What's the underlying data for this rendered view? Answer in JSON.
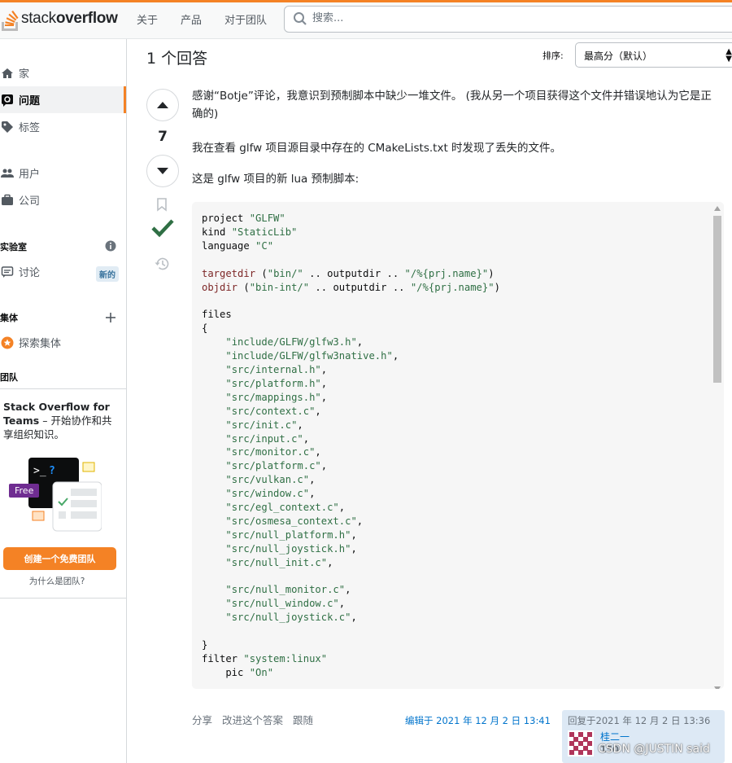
{
  "header": {
    "logo_plain": "stack",
    "logo_bold": "overflow",
    "nav": [
      "关于",
      "产品",
      "对于团队"
    ],
    "search_placeholder": "搜索..."
  },
  "sidebar": {
    "items": [
      {
        "label": "家",
        "icon": "home-icon"
      },
      {
        "label": "问题",
        "icon": "questions-icon",
        "active": true
      },
      {
        "label": "标签",
        "icon": "tag-icon"
      },
      {
        "label": "用户",
        "icon": "users-icon"
      },
      {
        "label": "公司",
        "icon": "briefcase-icon"
      }
    ],
    "labs_label": "实验室",
    "discussions_label": "讨论",
    "new_badge": "新的",
    "collectives_label": "集体",
    "explore_label": "探索集体",
    "teams_label": "团队",
    "teams_title": "Stack Overflow for Teams",
    "teams_desc": " – 开始协作和共享组织知识。",
    "free_badge": "Free",
    "cta_label": "创建一个免费团队",
    "why_link": "为什么是团队?"
  },
  "answers": {
    "count_label": "1 个回答",
    "sort_label": "排序:",
    "sort_value": "最高分（默认）"
  },
  "answer": {
    "votes": "7",
    "paragraphs": [
      "感谢“Botje”评论，我意识到预制脚本中缺少一堆文件。 (我从另一个项目获得这个文件并错误地认为它是正确的)",
      "我在查看 glfw 项目源目录中存在的 CMakeLists.txt 时发现了丢失的文件。",
      "这是 glfw 项目的新 lua 预制脚本:"
    ],
    "code_lines": [
      [
        [
          "",
          "project "
        ],
        [
          "str",
          "\"GLFW\""
        ]
      ],
      [
        [
          "",
          "kind "
        ],
        [
          "str",
          "\"StaticLib\""
        ]
      ],
      [
        [
          "",
          "language "
        ],
        [
          "str",
          "\"C\""
        ]
      ],
      [
        [
          "",
          ""
        ]
      ],
      [
        [
          "kw",
          "targetdir"
        ],
        [
          "",
          " ("
        ],
        [
          "str",
          "\"bin/\""
        ],
        [
          "",
          " .. outputdir .. "
        ],
        [
          "str",
          "\"/%{prj.name}\""
        ],
        [
          "",
          ")"
        ]
      ],
      [
        [
          "kw",
          "objdir"
        ],
        [
          "",
          " ("
        ],
        [
          "str",
          "\"bin-int/\""
        ],
        [
          "",
          " .. outputdir .. "
        ],
        [
          "str",
          "\"/%{prj.name}\""
        ],
        [
          "",
          ")"
        ]
      ],
      [
        [
          "",
          ""
        ]
      ],
      [
        [
          "",
          "files"
        ]
      ],
      [
        [
          "",
          "{"
        ]
      ],
      [
        [
          "",
          "    "
        ],
        [
          "str",
          "\"include/GLFW/glfw3.h\""
        ],
        [
          "",
          ","
        ]
      ],
      [
        [
          "",
          "    "
        ],
        [
          "str",
          "\"include/GLFW/glfw3native.h\""
        ],
        [
          "",
          ","
        ]
      ],
      [
        [
          "",
          "    "
        ],
        [
          "str",
          "\"src/internal.h\""
        ],
        [
          "",
          ","
        ]
      ],
      [
        [
          "",
          "    "
        ],
        [
          "str",
          "\"src/platform.h\""
        ],
        [
          "",
          ","
        ]
      ],
      [
        [
          "",
          "    "
        ],
        [
          "str",
          "\"src/mappings.h\""
        ],
        [
          "",
          ","
        ]
      ],
      [
        [
          "",
          "    "
        ],
        [
          "str",
          "\"src/context.c\""
        ],
        [
          "",
          ","
        ]
      ],
      [
        [
          "",
          "    "
        ],
        [
          "str",
          "\"src/init.c\""
        ],
        [
          "",
          ","
        ]
      ],
      [
        [
          "",
          "    "
        ],
        [
          "str",
          "\"src/input.c\""
        ],
        [
          "",
          ","
        ]
      ],
      [
        [
          "",
          "    "
        ],
        [
          "str",
          "\"src/monitor.c\""
        ],
        [
          "",
          ","
        ]
      ],
      [
        [
          "",
          "    "
        ],
        [
          "str",
          "\"src/platform.c\""
        ],
        [
          "",
          ","
        ]
      ],
      [
        [
          "",
          "    "
        ],
        [
          "str",
          "\"src/vulkan.c\""
        ],
        [
          "",
          ","
        ]
      ],
      [
        [
          "",
          "    "
        ],
        [
          "str",
          "\"src/window.c\""
        ],
        [
          "",
          ","
        ]
      ],
      [
        [
          "",
          "    "
        ],
        [
          "str",
          "\"src/egl_context.c\""
        ],
        [
          "",
          ","
        ]
      ],
      [
        [
          "",
          "    "
        ],
        [
          "str",
          "\"src/osmesa_context.c\""
        ],
        [
          "",
          ","
        ]
      ],
      [
        [
          "",
          "    "
        ],
        [
          "str",
          "\"src/null_platform.h\""
        ],
        [
          "",
          ","
        ]
      ],
      [
        [
          "",
          "    "
        ],
        [
          "str",
          "\"src/null_joystick.h\""
        ],
        [
          "",
          ","
        ]
      ],
      [
        [
          "",
          "    "
        ],
        [
          "str",
          "\"src/null_init.c\""
        ],
        [
          "",
          ","
        ]
      ],
      [
        [
          "",
          ""
        ]
      ],
      [
        [
          "",
          "    "
        ],
        [
          "str",
          "\"src/null_monitor.c\""
        ],
        [
          "",
          ","
        ]
      ],
      [
        [
          "",
          "    "
        ],
        [
          "str",
          "\"src/null_window.c\""
        ],
        [
          "",
          ","
        ]
      ],
      [
        [
          "",
          "    "
        ],
        [
          "str",
          "\"src/null_joystick.c\""
        ],
        [
          "",
          ","
        ]
      ],
      [
        [
          "",
          ""
        ]
      ],
      [
        [
          "",
          "}"
        ]
      ],
      [
        [
          "",
          "filter "
        ],
        [
          "str",
          "\"system:linux\""
        ]
      ],
      [
        [
          "",
          "    pic "
        ],
        [
          "str",
          "\"On\""
        ]
      ]
    ],
    "menu": [
      "分享",
      "改进这个答案",
      "跟随"
    ],
    "edited": "编辑于 2021 年 12 月 2 日 13:41",
    "answered": "回复于2021 年 12 月 2 日 13:36",
    "author": "桂二一",
    "reputation": "150",
    "watermark": "CSDN @JUSTIN said"
  }
}
